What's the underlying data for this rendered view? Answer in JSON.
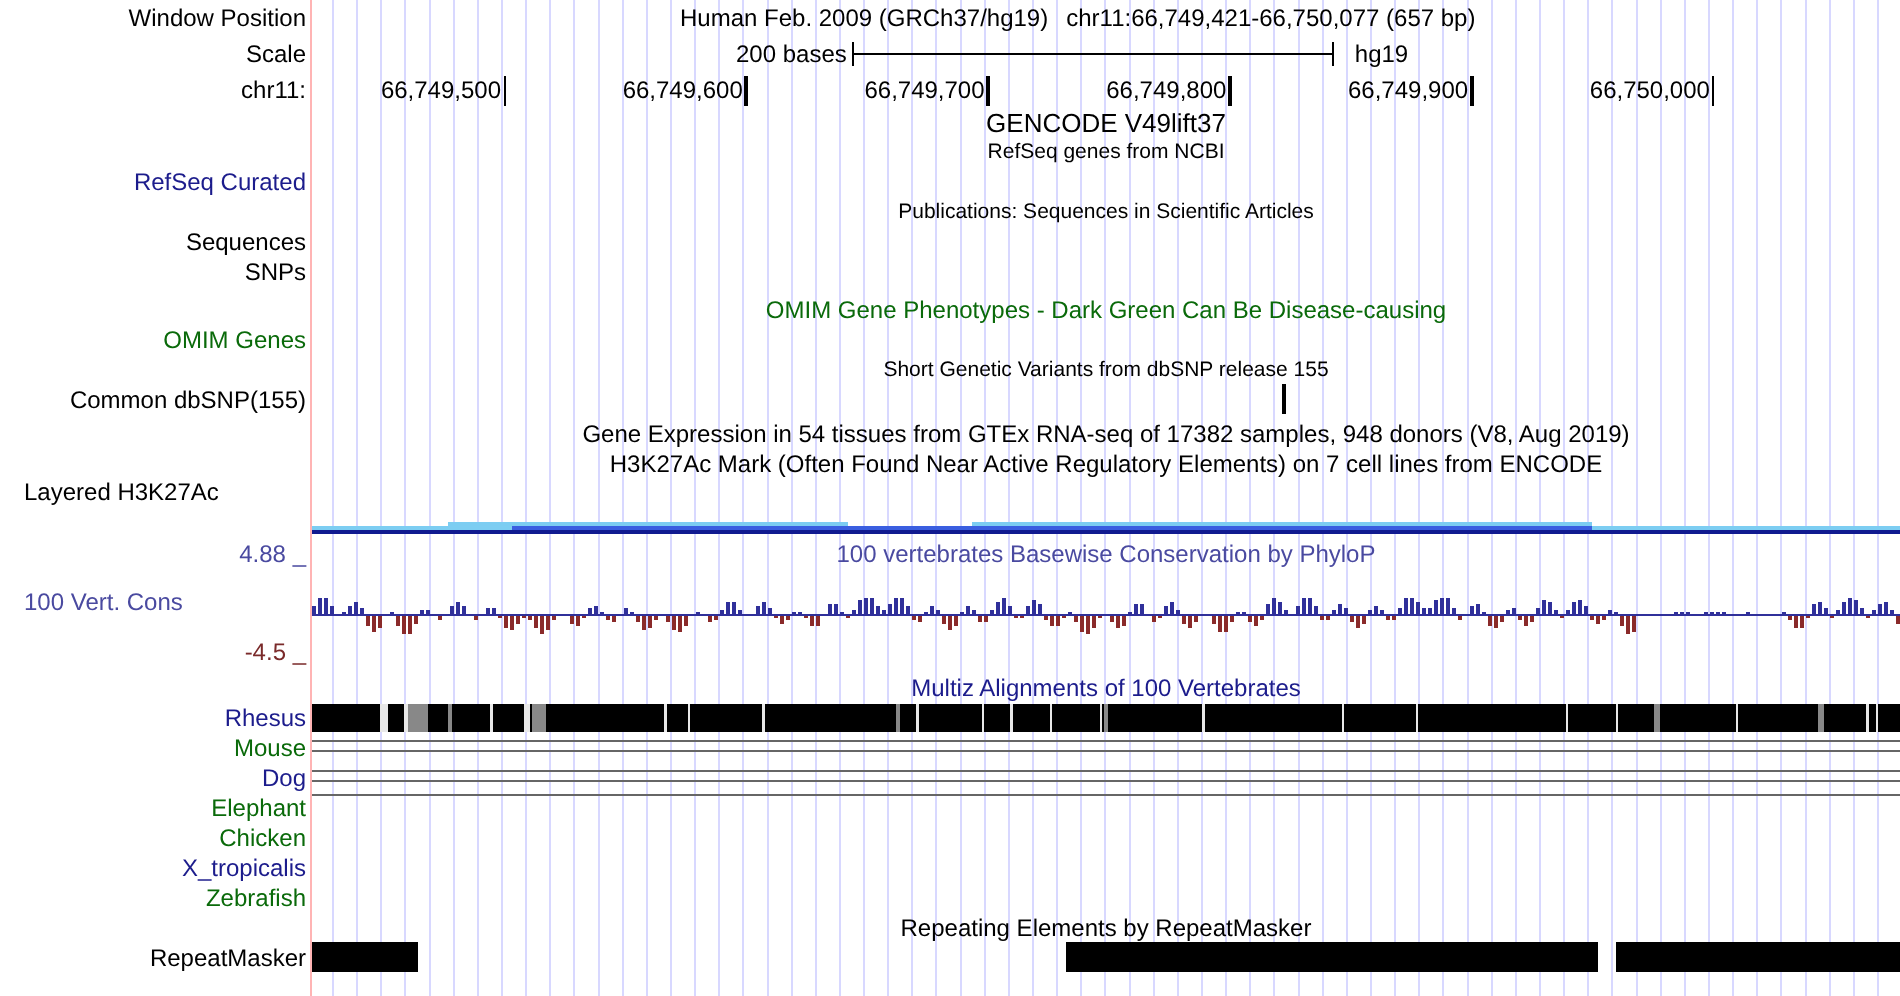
{
  "window_position": {
    "label": "Window Position",
    "title": "Human Feb. 2009 (GRCh37/hg19)",
    "position": "chr11:66,749,421-66,750,077 (657 bp)"
  },
  "scale": {
    "label": "Scale",
    "text": "200 bases",
    "assembly": "hg19"
  },
  "ruler": {
    "label": "chr11:",
    "ticks": [
      "66,749,500",
      "66,749,600",
      "66,749,700",
      "66,749,800",
      "66,749,900",
      "66,750,000"
    ]
  },
  "tracks": [
    {
      "title": "GENCODE V49lift37",
      "kind": "large",
      "color": "#000000"
    },
    {
      "title": "RefSeq genes from NCBI",
      "kind": "small",
      "color": "#000000",
      "rows": [
        {
          "label": "RefSeq Curated",
          "color": "#1c1c8c",
          "kind": "empty"
        }
      ]
    },
    {
      "title": "Publications: Sequences in Scientific Articles",
      "kind": "small",
      "color": "#000000",
      "rows": [
        {
          "label": "Sequences",
          "color": "#000000",
          "kind": "empty"
        }
      ]
    },
    {
      "rows": [
        {
          "label": "SNPs",
          "color": "#000000",
          "kind": "empty"
        }
      ]
    },
    {
      "title": "OMIM Gene Phenotypes - Dark Green Can Be Disease-causing",
      "kind": "normal",
      "color": "#0a6a0a",
      "rows": [
        {
          "label": "OMIM Genes",
          "color": "#0a6a0a",
          "kind": "empty"
        }
      ]
    },
    {
      "title": "Short Genetic Variants from dbSNP release 155",
      "kind": "small",
      "color": "#000000",
      "rows": [
        {
          "label": "Common dbSNP(155)",
          "color": "#000000",
          "kind": "tick"
        }
      ]
    },
    {
      "title": "Gene Expression in 54 tissues from GTEx RNA-seq of 17382 samples, 948 donors (V8, Aug 2019)",
      "kind": "normal",
      "color": "#000000"
    },
    {
      "title": "H3K27Ac Mark (Often Found Near Active Regulatory Elements) on 7 cell lines from ENCODE",
      "kind": "normal",
      "color": "#000000",
      "rows": [
        {
          "label": "Layered H3K27Ac",
          "color": "#000000",
          "kind": "layered"
        }
      ]
    },
    {
      "title": "100 vertebrates Basewise Conservation by PhyloP",
      "kind": "normal",
      "color": "#4a4aa0",
      "scale_max": "4.88 _",
      "rows": [
        {
          "label": "100 Vert. Cons",
          "color": "#4a4aa0",
          "kind": "wiggle",
          "scale_min": "-4.5 _"
        }
      ]
    },
    {
      "title": "Multiz Alignments of 100 Vertebrates",
      "kind": "normal",
      "color": "#1c1c8c",
      "rows": [
        {
          "label": "Rhesus",
          "color": "#1c1c8c",
          "kind": "alignment"
        },
        {
          "label": "Mouse",
          "color": "#0a6a0a",
          "kind": "double_line"
        },
        {
          "label": "Dog",
          "color": "#1c1c8c",
          "kind": "double_line"
        },
        {
          "label": "Elephant",
          "color": "#0a6a0a",
          "kind": "single_line"
        },
        {
          "label": "Chicken",
          "color": "#0a6a0a",
          "kind": "empty"
        },
        {
          "label": "X_tropicalis",
          "color": "#1c1c8c",
          "kind": "empty"
        },
        {
          "label": "Zebrafish",
          "color": "#0a6a0a",
          "kind": "empty"
        }
      ]
    },
    {
      "title": "Repeating Elements by RepeatMasker",
      "kind": "normal",
      "color": "#000000",
      "rows": [
        {
          "label": "RepeatMasker",
          "color": "#000000",
          "kind": "blocks"
        }
      ]
    }
  ]
}
